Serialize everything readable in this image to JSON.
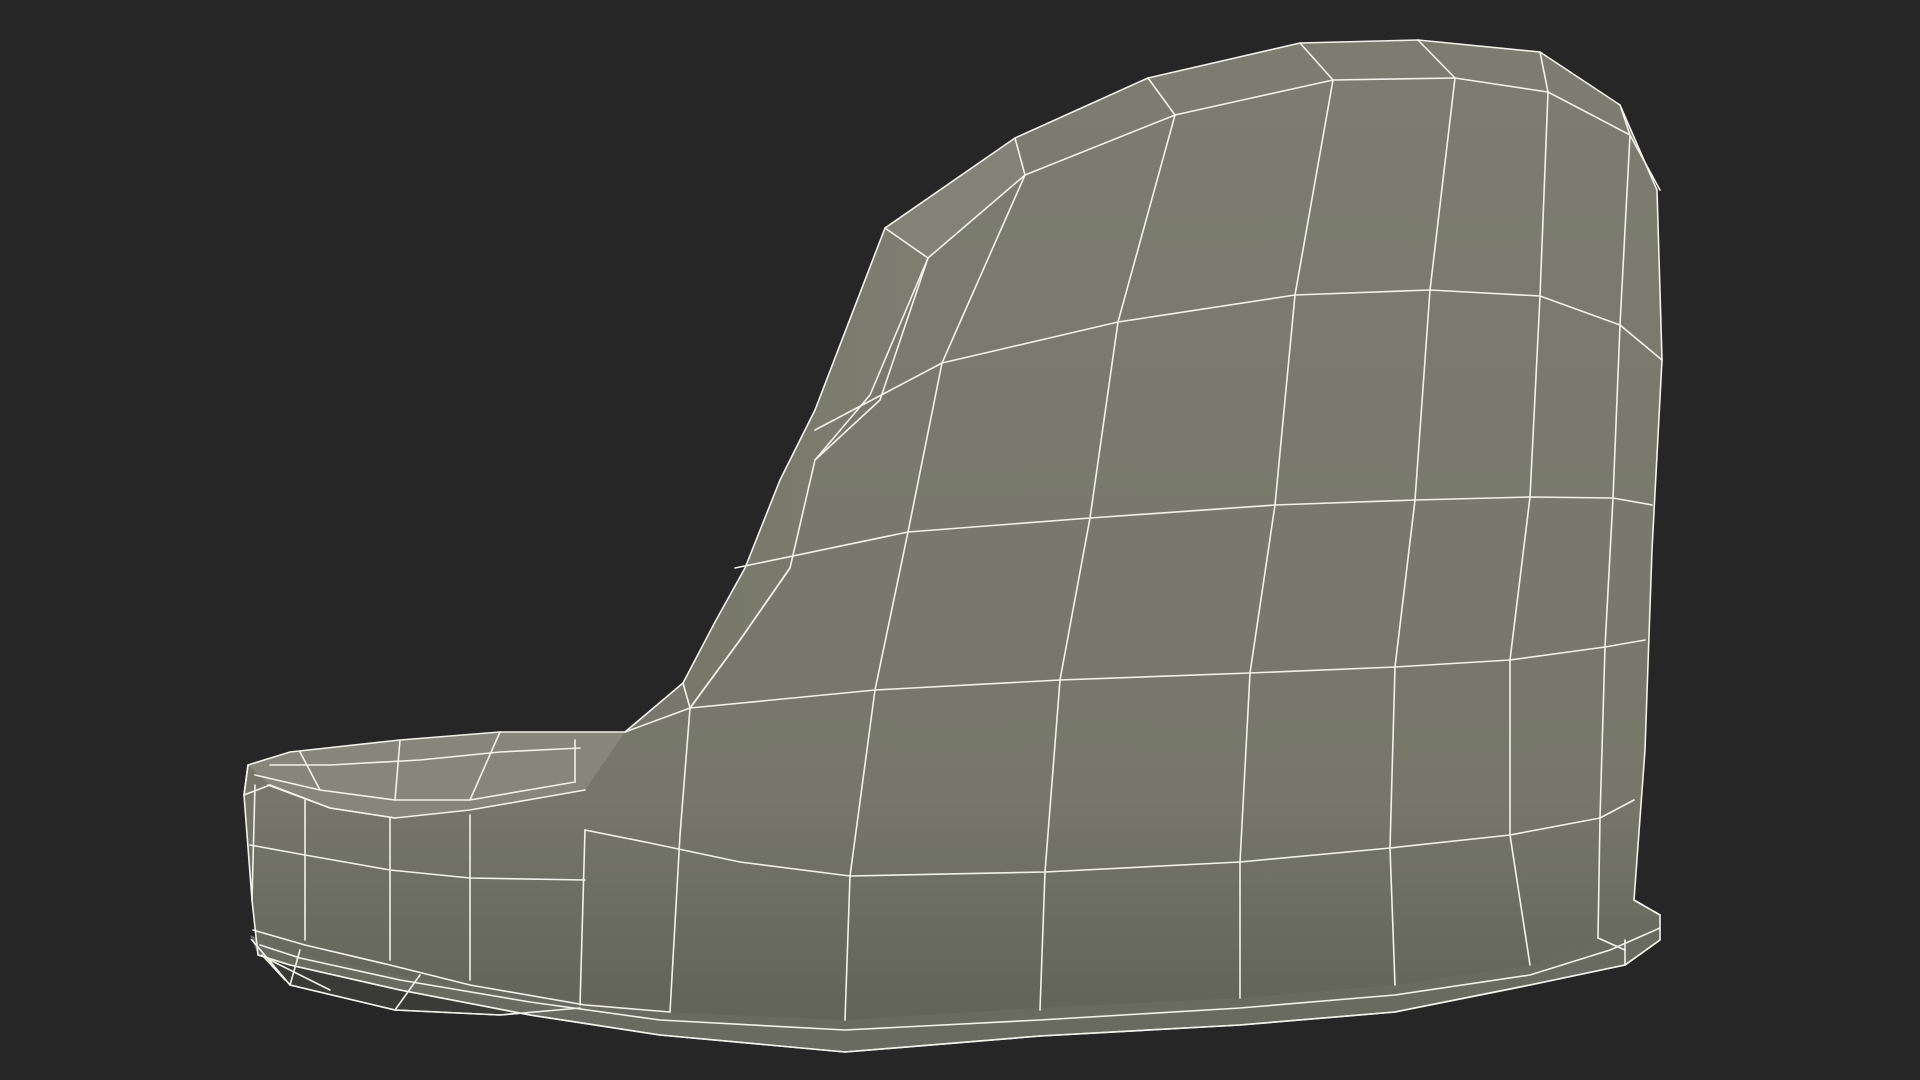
{
  "scene": {
    "subject": "seat-shell-wireframe",
    "colors": {
      "background": "#262626",
      "surface": "#7c7d70",
      "surface_shade": "#6f7064",
      "surface_dark": "#5d5e54",
      "underside": "#3a3b36",
      "wire": "#f2f2ea"
    }
  }
}
